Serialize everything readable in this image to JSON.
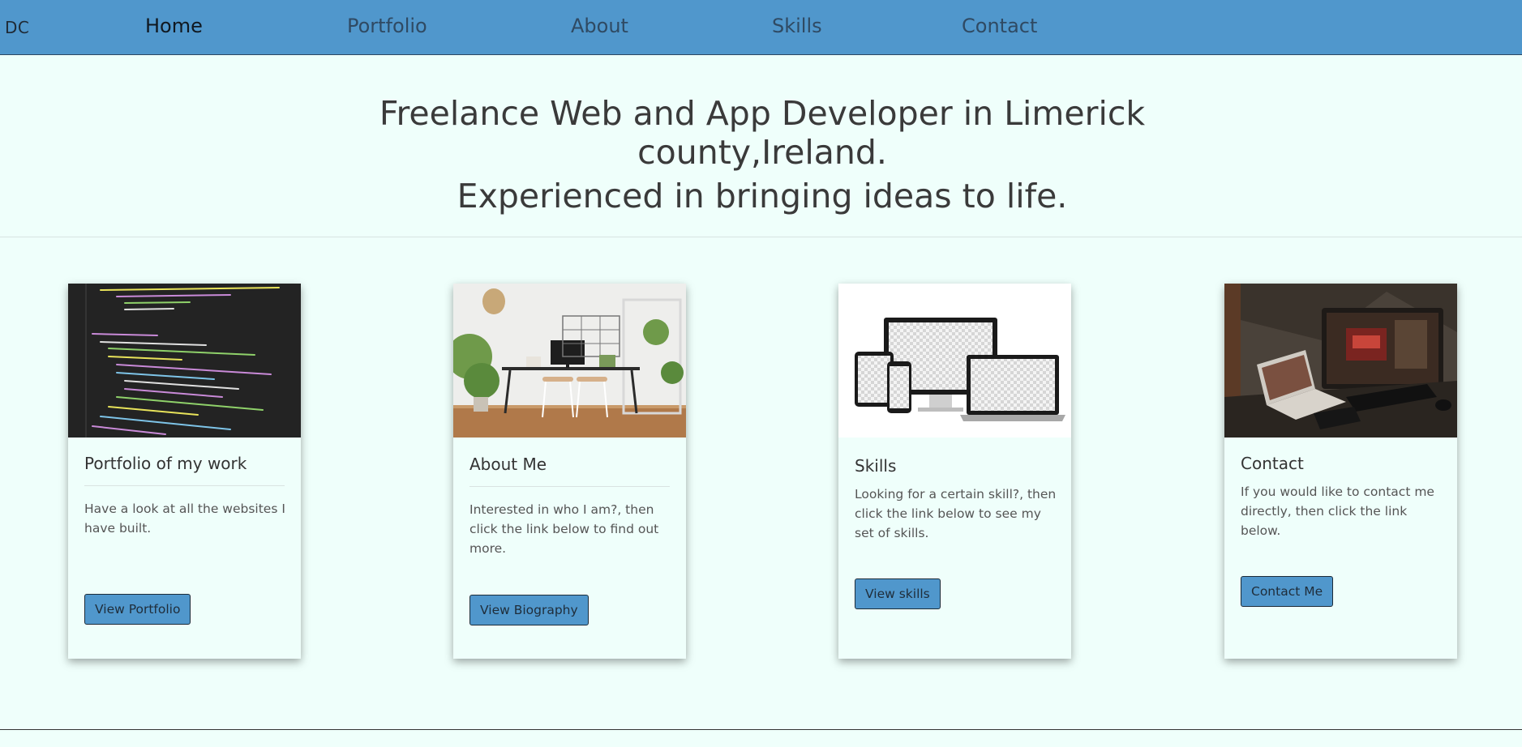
{
  "nav": {
    "brand": "DC",
    "links": [
      "Home",
      "Portfolio",
      "About",
      "Skills",
      "Contact"
    ]
  },
  "hero": {
    "title": "Freelance Web and App Developer in Limerick county,Ireland.",
    "subtitle": "Experienced in bringing ideas to life."
  },
  "cards": [
    {
      "title": "Portfolio of my work",
      "text": "Have a look at all the websites I have built.",
      "button": "View Portfolio",
      "image": "code-editor-image"
    },
    {
      "title": "About Me",
      "text": "Interested in who I am?, then click the link below to find out more.",
      "button": "View Biography",
      "image": "desk-workspace-image"
    },
    {
      "title": "Skills",
      "text": "Looking for a certain skill?, then click the link below to see my set of skills.",
      "button": "View skills",
      "image": "responsive-devices-image"
    },
    {
      "title": "Contact",
      "text": "If you would like to contact me directly, then click the link below.",
      "button": "Contact Me",
      "image": "laptop-desk-image"
    }
  ],
  "colors": {
    "navbar": "#5097cc",
    "background": "#effffb",
    "button": "#5097cc"
  }
}
